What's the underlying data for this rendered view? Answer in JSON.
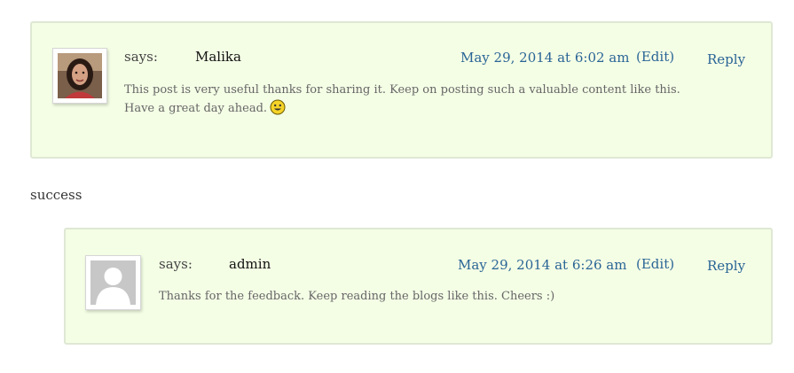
{
  "comments": [
    {
      "says_label": "says:",
      "author": "Malika",
      "date": "May 29, 2014 at 6:02 am",
      "edit_label": "(Edit)",
      "reply_label": "Reply",
      "body_line1": "This post is very useful thanks for sharing it. Keep on posting such a valuable content like this.",
      "body_line2": "Have a great day ahead.",
      "emoji_icon": "smiley-face-icon",
      "avatar": "user-photo-avatar"
    },
    {
      "says_label": "says:",
      "author": "admin",
      "date": "May 29, 2014 at 6:26 am",
      "edit_label": "(Edit)",
      "reply_label": "Reply",
      "body": "Thanks for the feedback. Keep reading the blogs like this. Cheers :)",
      "avatar": "default-user-avatar"
    }
  ],
  "status_text": "success",
  "colors": {
    "comment_bg": "#f4fee5",
    "comment_border": "#dfe8d4",
    "link": "#2a6496"
  }
}
